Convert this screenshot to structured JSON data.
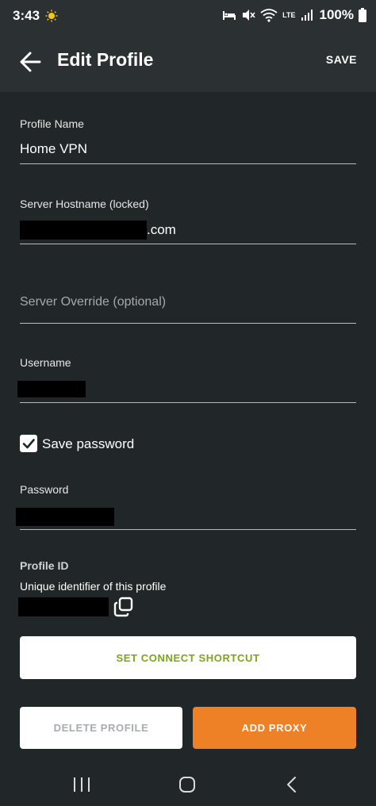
{
  "status_bar": {
    "time": "3:43",
    "battery": "100%",
    "network_lte": "LTE"
  },
  "app_bar": {
    "title": "Edit Profile",
    "save_label": "SAVE"
  },
  "form": {
    "profile_name": {
      "label": "Profile Name",
      "value": "Home VPN"
    },
    "server_hostname": {
      "label": "Server Hostname (locked)",
      "value_suffix": ".com"
    },
    "server_override": {
      "placeholder": "Server Override (optional)"
    },
    "username": {
      "label": "Username"
    },
    "save_password": {
      "label": "Save password",
      "checked": true
    },
    "password": {
      "label": "Password"
    },
    "profile_id": {
      "title": "Profile ID",
      "description": "Unique identifier of this profile"
    }
  },
  "buttons": {
    "set_connect_shortcut": "SET CONNECT SHORTCUT",
    "delete_profile": "DELETE PROFILE",
    "add_proxy": "ADD PROXY"
  },
  "colors": {
    "background": "#212629",
    "app_bar": "#2b3033",
    "accent_green": "#7ca321",
    "accent_orange": "#ee8026"
  }
}
